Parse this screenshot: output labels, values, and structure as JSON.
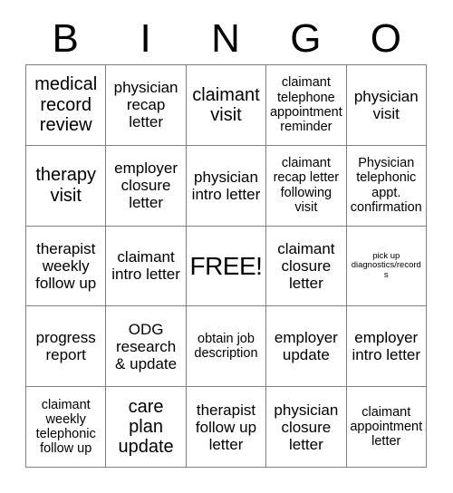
{
  "card": {
    "title": "BINGO",
    "header_letters": [
      "B",
      "I",
      "N",
      "G",
      "O"
    ],
    "colors": {
      "background": "#ffffff",
      "text": "#000000",
      "grid_line": "#808080"
    },
    "grid": {
      "columns": 5,
      "rows": 5,
      "free_space": {
        "row": 3,
        "column": 3,
        "label": "FREE!"
      }
    },
    "cells": [
      [
        {
          "text": "medical record review",
          "size": "lg"
        },
        {
          "text": "physician recap letter",
          "size": "md"
        },
        {
          "text": "claimant visit",
          "size": "lg"
        },
        {
          "text": "claimant telephone appointment reminder",
          "size": "sm"
        },
        {
          "text": "physician visit",
          "size": "md"
        }
      ],
      [
        {
          "text": "therapy visit",
          "size": "lg"
        },
        {
          "text": "employer closure letter",
          "size": "md"
        },
        {
          "text": "physician intro letter",
          "size": "md"
        },
        {
          "text": "claimant recap letter following visit",
          "size": "sm"
        },
        {
          "text": "Physician telephonic appt. confirmation",
          "size": "sm"
        }
      ],
      [
        {
          "text": "therapist weekly follow up",
          "size": "md"
        },
        {
          "text": "claimant intro letter",
          "size": "md"
        },
        {
          "text": "FREE!",
          "size": "free"
        },
        {
          "text": "claimant closure letter",
          "size": "md"
        },
        {
          "text": "pick up diagnostics/records",
          "size": "xs"
        }
      ],
      [
        {
          "text": "progress report",
          "size": "md"
        },
        {
          "text": "ODG research & update",
          "size": "md"
        },
        {
          "text": "obtain job description",
          "size": "sm"
        },
        {
          "text": "employer update",
          "size": "md"
        },
        {
          "text": "employer intro letter",
          "size": "md"
        }
      ],
      [
        {
          "text": "claimant weekly telephonic follow up",
          "size": "sm"
        },
        {
          "text": "care plan update",
          "size": "lg"
        },
        {
          "text": "therapist follow up letter",
          "size": "md"
        },
        {
          "text": "physician closure letter",
          "size": "md"
        },
        {
          "text": "claimant appointment letter",
          "size": "sm"
        }
      ]
    ]
  }
}
